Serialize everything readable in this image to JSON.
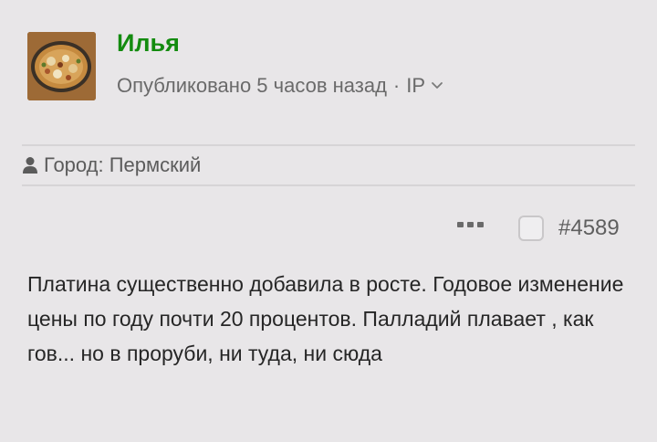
{
  "author": {
    "name": "Илья"
  },
  "meta": {
    "published": "Опубликовано 5 часов назад",
    "separator": "·",
    "ip_label": "IP"
  },
  "location": {
    "text": "Город: Пермский"
  },
  "post": {
    "number": "#4589",
    "body": "Платина существенно добавила в росте. Годовое изменение цены по году почти 20 процентов. Палладий плавает , как гов... но в проруби, ни туда, ни сюда"
  },
  "icons": {
    "user": "user-icon",
    "more": "more-dots-icon",
    "chevron": "chevron-down-icon"
  },
  "colors": {
    "author_name": "#138b0f",
    "background": "#e8e6e8"
  }
}
